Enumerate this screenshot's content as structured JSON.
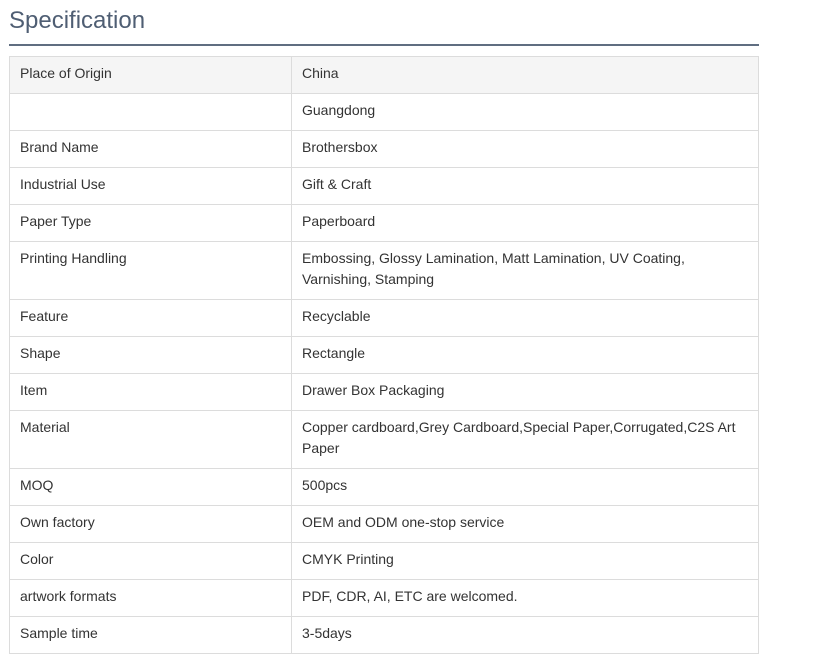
{
  "page": {
    "title": "Specification"
  },
  "spec_rows": [
    {
      "key": "Place of Origin",
      "value": "China"
    },
    {
      "key": "",
      "value": "Guangdong"
    },
    {
      "key": "Brand Name",
      "value": "Brothersbox"
    },
    {
      "key": "Industrial Use",
      "value": "Gift & Craft"
    },
    {
      "key": "Paper Type",
      "value": "Paperboard"
    },
    {
      "key": "Printing Handling",
      "value": "Embossing, Glossy Lamination, Matt Lamination, UV Coating, Varnishing, Stamping"
    },
    {
      "key": "Feature",
      "value": "Recyclable"
    },
    {
      "key": "Shape",
      "value": "Rectangle"
    },
    {
      "key": "Item",
      "value": "Drawer Box Packaging"
    },
    {
      "key": "Material",
      "value": "Copper cardboard,Grey Cardboard,Special Paper,Corrugated,C2S Art Paper"
    },
    {
      "key": "MOQ",
      "value": "500pcs"
    },
    {
      "key": "Own factory",
      "value": "OEM and ODM one-stop service"
    },
    {
      "key": "Color",
      "value": "CMYK Printing"
    },
    {
      "key": "artwork formats",
      "value": "PDF, CDR, AI, ETC are welcomed."
    },
    {
      "key": "Sample time",
      "value": "3-5days"
    }
  ],
  "colors": {
    "title": "#4f5e73",
    "border": "#dcdcdc",
    "header_row_bg": "#f5f5f5"
  }
}
